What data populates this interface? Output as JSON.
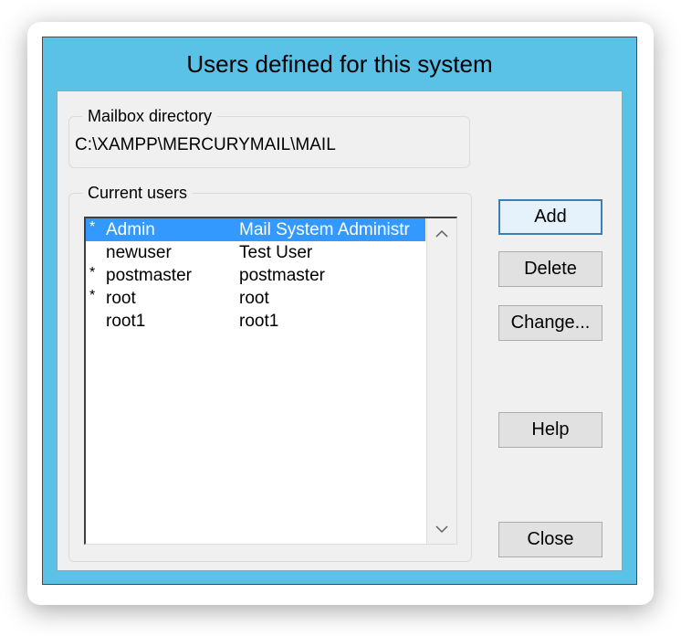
{
  "window": {
    "title": "Users defined for this system"
  },
  "mailbox": {
    "label": "Mailbox directory",
    "path": "C:\\XAMPP\\MERCURYMAIL\\MAIL"
  },
  "users": {
    "label": "Current users",
    "selected_index": 0,
    "items": [
      {
        "flag": "*",
        "username": "Admin",
        "fullname": "Mail System Administr"
      },
      {
        "flag": "",
        "username": "newuser",
        "fullname": "Test User"
      },
      {
        "flag": "*",
        "username": "postmaster",
        "fullname": "postmaster"
      },
      {
        "flag": "*",
        "username": "root",
        "fullname": "root"
      },
      {
        "flag": "",
        "username": "root1",
        "fullname": "root1"
      }
    ]
  },
  "buttons": {
    "add": "Add",
    "delete": "Delete",
    "change": "Change...",
    "help": "Help",
    "close": "Close"
  },
  "colors": {
    "frame": "#5bc2e7",
    "dialog_bg": "#f0f0f0",
    "selection": "#3399ff",
    "default_button_border": "#3c7fb1"
  },
  "icons": {
    "scroll_up": "chevron-up-icon",
    "scroll_down": "chevron-down-icon"
  }
}
